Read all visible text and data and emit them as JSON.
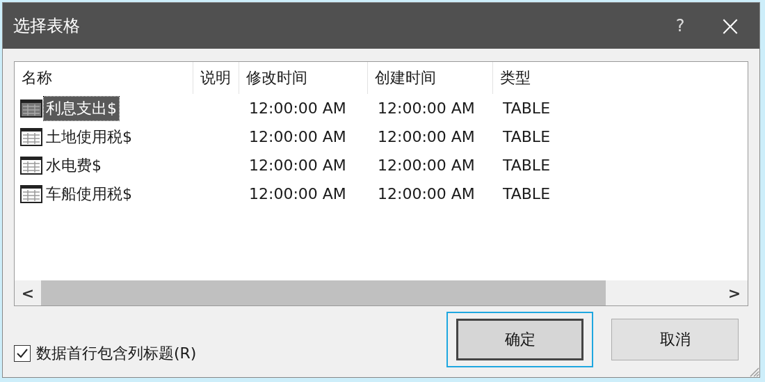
{
  "window": {
    "title": "选择表格",
    "help": "?",
    "close": "×"
  },
  "table": {
    "columns": [
      "名称",
      "说明",
      "修改时间",
      "创建时间",
      "类型"
    ],
    "rows": [
      {
        "name": "利息支出$",
        "modified": "12:00:00 AM",
        "created": "12:00:00 AM",
        "type": "TABLE",
        "selected": true
      },
      {
        "name": "土地使用税$",
        "modified": "12:00:00 AM",
        "created": "12:00:00 AM",
        "type": "TABLE",
        "selected": false
      },
      {
        "name": "水电费$",
        "modified": "12:00:00 AM",
        "created": "12:00:00 AM",
        "type": "TABLE",
        "selected": false
      },
      {
        "name": "车船使用税$",
        "modified": "12:00:00 AM",
        "created": "12:00:00 AM",
        "type": "TABLE",
        "selected": false
      }
    ]
  },
  "scroll": {
    "left": "<",
    "right": ">"
  },
  "checkbox": {
    "label": "数据首行包含列标题(R)",
    "checked": true
  },
  "buttons": [
    {
      "label": "确定",
      "focused": true
    },
    {
      "label": "取消",
      "focused": false
    }
  ]
}
